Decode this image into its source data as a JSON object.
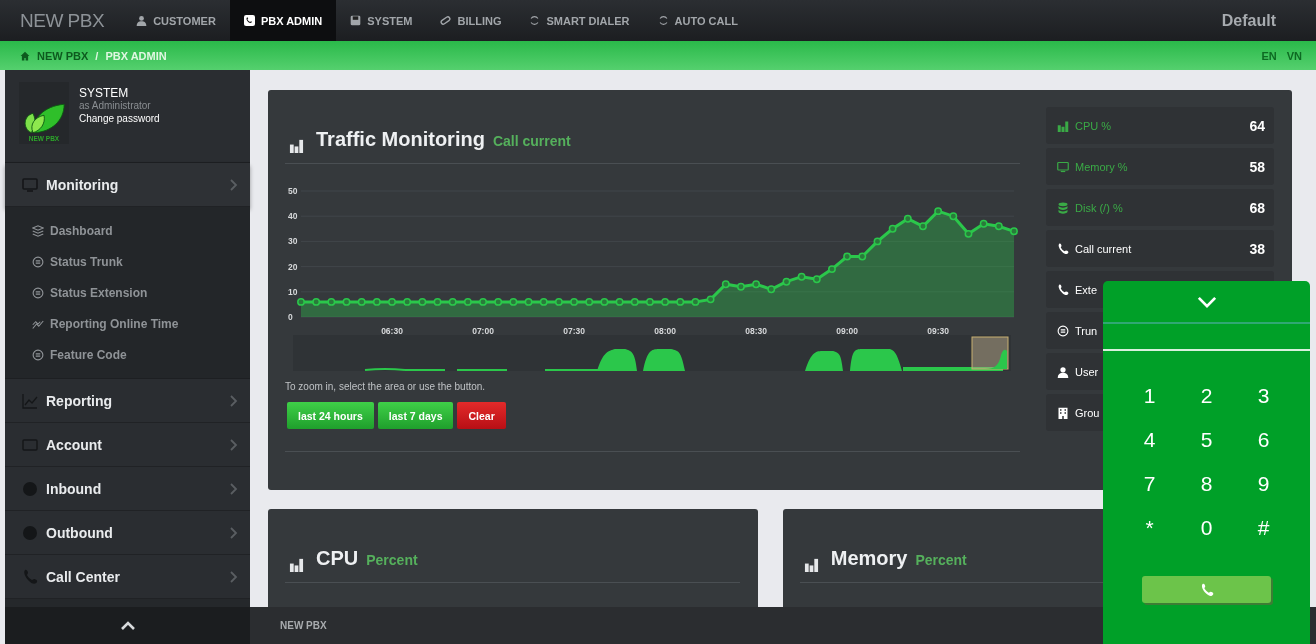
{
  "top_nav": {
    "brand": "NEW PBX",
    "tabs": [
      {
        "label": "CUSTOMER",
        "selected": false
      },
      {
        "label": "PBX ADMIN",
        "selected": true
      },
      {
        "label": "SYSTEM",
        "selected": false
      },
      {
        "label": "BILLING",
        "selected": false
      },
      {
        "label": "SMART DIALER",
        "selected": false
      },
      {
        "label": "AUTO CALL",
        "selected": false
      }
    ],
    "profile": "Default"
  },
  "breadcrumb": {
    "items": [
      "NEW PBX",
      "PBX ADMIN"
    ],
    "separator": "/",
    "languages": [
      "EN",
      "VN"
    ]
  },
  "sidebar": {
    "user": {
      "logo_text": "NEW PBX",
      "name": "SYSTEM",
      "role": "as Administrator",
      "link": "Change password"
    },
    "menu": [
      {
        "label": "Monitoring",
        "expanded": true,
        "children": [
          {
            "label": "Dashboard"
          },
          {
            "label": "Status Trunk"
          },
          {
            "label": "Status Extension"
          },
          {
            "label": "Reporting Online Time"
          },
          {
            "label": "Feature Code"
          }
        ]
      },
      {
        "label": "Reporting",
        "expanded": false
      },
      {
        "label": "Account",
        "expanded": false
      },
      {
        "label": "Inbound",
        "expanded": false
      },
      {
        "label": "Outbound",
        "expanded": false
      },
      {
        "label": "Call Center",
        "expanded": false
      }
    ]
  },
  "traffic_card": {
    "title": "Traffic Monitoring",
    "subtitle": "Call current",
    "chart_data": {
      "type": "area",
      "xlim": [
        360,
        595
      ],
      "x": [
        360,
        365,
        370,
        375,
        380,
        385,
        390,
        395,
        400,
        405,
        410,
        415,
        420,
        425,
        430,
        435,
        440,
        445,
        450,
        455,
        460,
        465,
        470,
        475,
        480,
        485,
        490,
        495,
        500,
        505,
        510,
        515,
        520,
        525,
        530,
        535,
        540,
        545,
        550,
        555,
        560,
        565,
        570,
        575,
        580,
        585,
        590,
        595
      ],
      "grid": true,
      "series": [
        {
          "color": "#2bc74b",
          "values": [
            6,
            6,
            6,
            6,
            6,
            6,
            6,
            6,
            6,
            6,
            6,
            6,
            6,
            6,
            6,
            6,
            6,
            6,
            6,
            6,
            6,
            6,
            6,
            6,
            6,
            6,
            6,
            7,
            13,
            12,
            13,
            11,
            14,
            16,
            15,
            19,
            24,
            24,
            30,
            35,
            39,
            36,
            42,
            40,
            33,
            37,
            36,
            34
          ]
        }
      ],
      "ylim": [
        0,
        50
      ],
      "yticks": [
        0,
        10,
        20,
        30,
        40,
        50
      ],
      "xticks": [
        {
          "value": 390,
          "label": "06:30"
        },
        {
          "value": 420,
          "label": "07:00"
        },
        {
          "value": 450,
          "label": "07:30"
        },
        {
          "value": 480,
          "label": "08:00"
        },
        {
          "value": 510,
          "label": "08:30"
        },
        {
          "value": 540,
          "label": "09:00"
        },
        {
          "value": 570,
          "label": "09:30"
        }
      ]
    },
    "hint": "To zoom in, select the area or use the button.",
    "buttons": [
      {
        "label": "last 24 hours",
        "kind": "primary"
      },
      {
        "label": "last 7 days",
        "kind": "primary"
      },
      {
        "label": "Clear",
        "kind": "danger"
      }
    ],
    "stats": [
      {
        "label": "CPU %",
        "value": "64",
        "color": "#3aaa46"
      },
      {
        "label": "Memory %",
        "value": "58",
        "color": "#3aaa46"
      },
      {
        "label": "Disk (/) %",
        "value": "68",
        "color": "#3aaa46"
      },
      {
        "label": "Call current",
        "value": "38",
        "color": "#ffffff"
      },
      {
        "label": "Exte",
        "color": "#ffffff"
      },
      {
        "label": "Trun",
        "color": "#ffffff"
      },
      {
        "label": "User",
        "color": "#ffffff"
      },
      {
        "label": "Grou",
        "color": "#ffffff"
      }
    ]
  },
  "cpu_card": {
    "title": "CPU",
    "subtitle": "Percent"
  },
  "memory_card": {
    "title": "Memory",
    "subtitle": "Percent"
  },
  "footer": {
    "text": "NEW PBX"
  },
  "dialpad": {
    "keys": [
      "1",
      "2",
      "3",
      "4",
      "5",
      "6",
      "7",
      "8",
      "9",
      "*",
      "0",
      "#"
    ]
  }
}
